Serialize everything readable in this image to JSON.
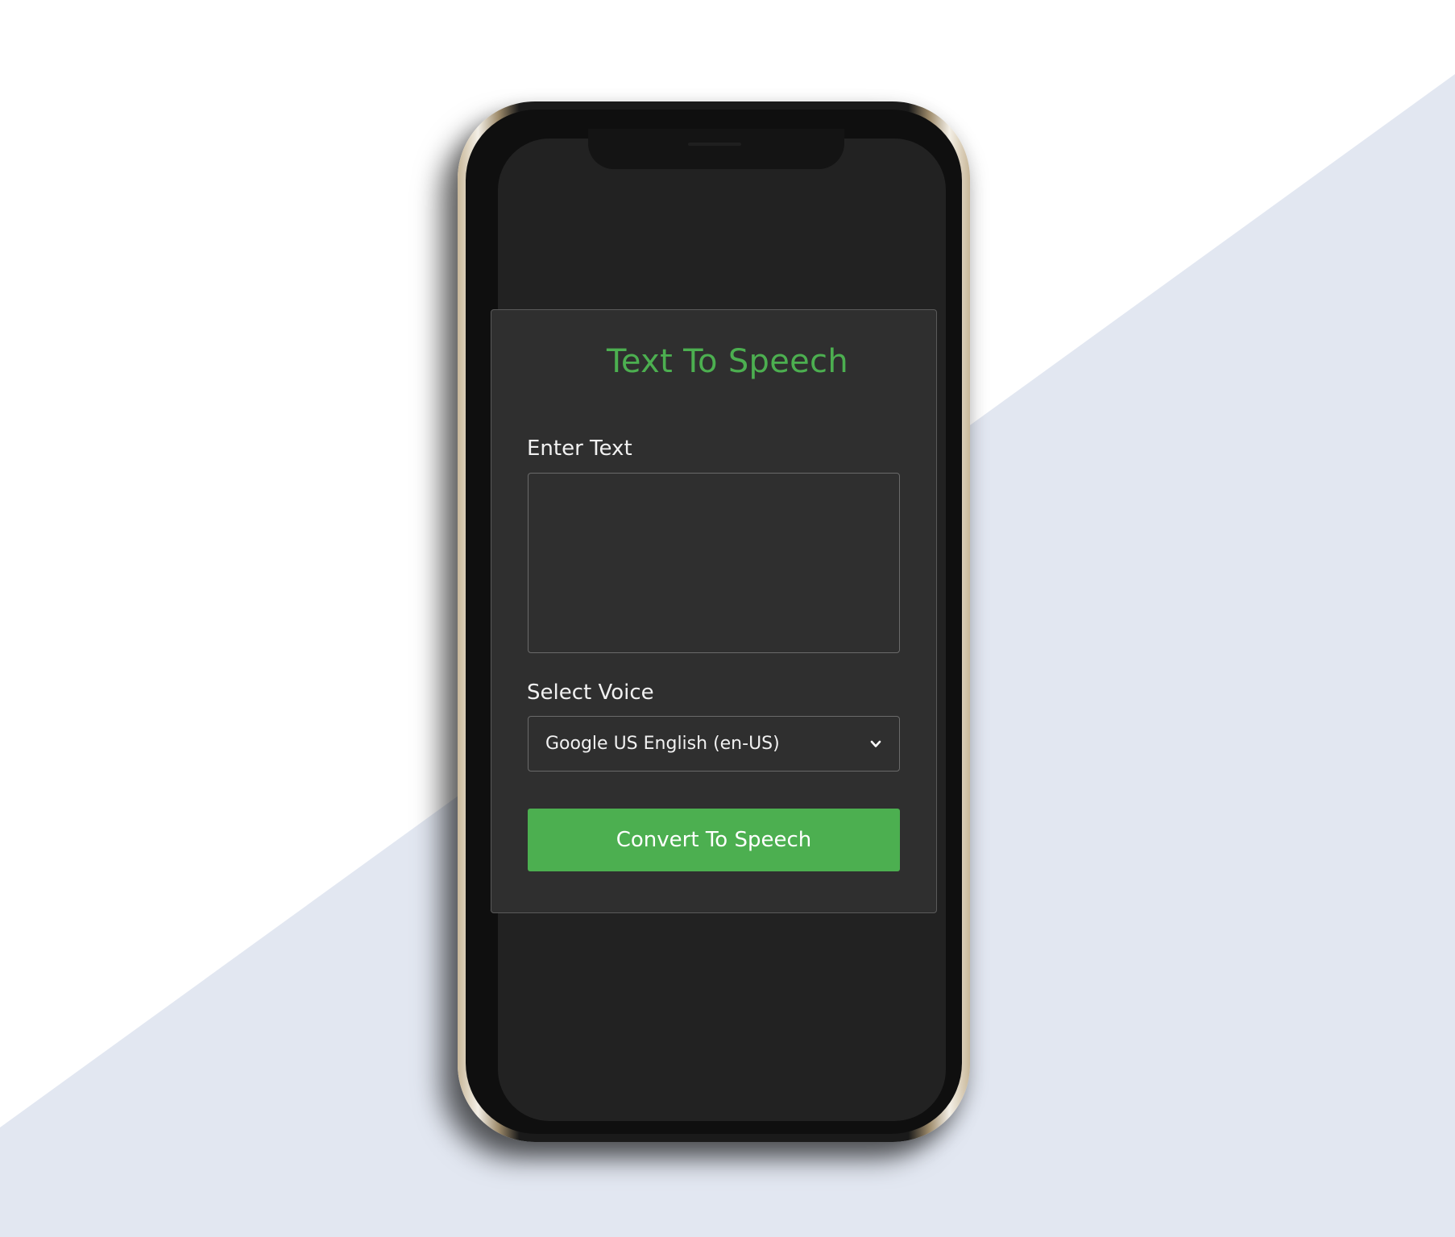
{
  "colors": {
    "accent": "#4caf50",
    "background_white": "#ffffff",
    "background_blue": "#e2e7f1",
    "card_background": "#2f2f2f",
    "screen_background": "#222222"
  },
  "app": {
    "title": "Text To Speech",
    "text_label": "Enter Text",
    "text_value": "",
    "voice_label": "Select Voice",
    "voice_selected": "Google US English (en-US)",
    "convert_label": "Convert To Speech"
  },
  "icons": {
    "select": "chevron-down-icon"
  }
}
